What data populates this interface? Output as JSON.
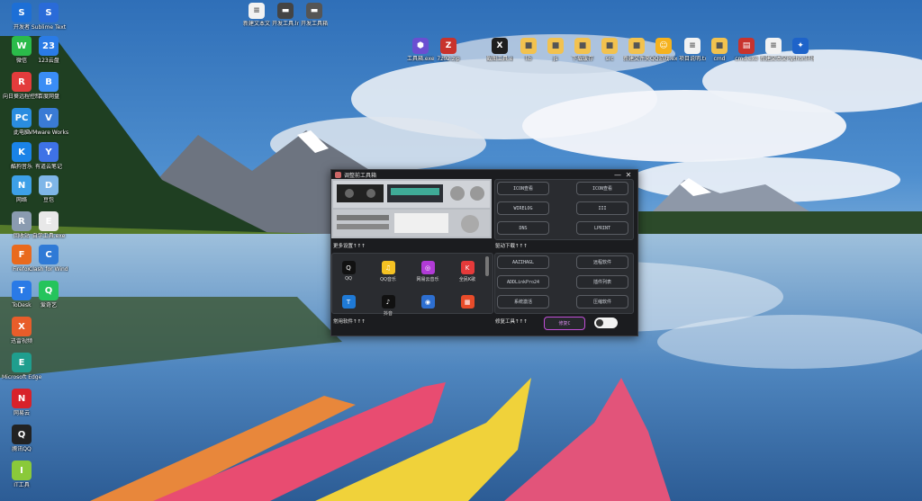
{
  "desktop": {
    "left_icons": [
      {
        "label": "开发者",
        "color": "#1d6fd6",
        "glyph": "S"
      },
      {
        "label": "Sublime Text",
        "color": "#2a6bd8",
        "glyph": "S"
      },
      {
        "label": "微信",
        "color": "#2bbb4a",
        "glyph": "W"
      },
      {
        "label": "123云盘",
        "color": "#2a7be6",
        "glyph": "23"
      },
      {
        "label": "向日葵远程控制",
        "color": "#e33c3c",
        "glyph": "R"
      },
      {
        "label": "百度网盘",
        "color": "#3a8df5",
        "glyph": "B"
      },
      {
        "label": "此电脑",
        "color": "#2a8de0",
        "glyph": "PC"
      },
      {
        "label": "VMware Workstat...",
        "color": "#3a7bd5",
        "glyph": "V"
      },
      {
        "label": "酷狗音乐",
        "color": "#1a83e8",
        "glyph": "K"
      },
      {
        "label": "有道云笔记",
        "color": "#3e72e6",
        "glyph": "Y"
      },
      {
        "label": "网络",
        "color": "#3da0e8",
        "glyph": "N"
      },
      {
        "label": "豆包",
        "color": "#7fb6e8",
        "glyph": "D"
      },
      {
        "label": "回收站",
        "color": "#8a9bb0",
        "glyph": "R"
      },
      {
        "label": "自学工具.exe",
        "color": "#e8e8e8",
        "glyph": "E"
      },
      {
        "label": "Firefox",
        "color": "#e96a1e",
        "glyph": "F"
      },
      {
        "label": "Clash for Windows",
        "color": "#2f7ad6",
        "glyph": "C"
      },
      {
        "label": "ToDesk",
        "color": "#2a7ae6",
        "glyph": "T"
      },
      {
        "label": "爱奇艺",
        "color": "#25c45c",
        "glyph": "Q"
      },
      {
        "label": "迅雷视频",
        "color": "#e85d2a",
        "glyph": "X"
      },
      {
        "label": "Microsoft Edge",
        "color": "#1f9e8e",
        "glyph": "E"
      },
      {
        "label": "网易云",
        "color": "#d8222a",
        "glyph": "N"
      },
      {
        "label": "腾讯QQ",
        "color": "#222",
        "glyph": "Q"
      },
      {
        "label": "IT工具",
        "color": "#8ac93a",
        "glyph": "I"
      }
    ],
    "top_icons": [
      {
        "label": "新建文本文档.txt",
        "color": "#f2f2f2",
        "glyph": "≡"
      },
      {
        "label": "开发工具.lnk",
        "color": "#444",
        "glyph": "▬"
      },
      {
        "label": "开发工具箱.lnk",
        "color": "#555",
        "glyph": "▬"
      },
      {
        "label": "工具箱.exe",
        "color": "#6a4fd1",
        "glyph": "⬢"
      },
      {
        "label": "7z02.zip",
        "color": "#c8332d",
        "glyph": "Z"
      },
      {
        "label": "截图工具.exe",
        "color": "#1e1e1e",
        "glyph": "X"
      },
      {
        "label": "lib",
        "color": "#f2c24f",
        "glyph": "■"
      },
      {
        "label": "js",
        "color": "#f2c24f",
        "glyph": "■"
      },
      {
        "label": "下载缓存",
        "color": "#f2c24f",
        "glyph": "■"
      },
      {
        "label": "src",
        "color": "#f2c24f",
        "glyph": "■"
      },
      {
        "label": "新建文件夹",
        "color": "#f2c24f",
        "glyph": "■"
      },
      {
        "label": "QQ游戏.exe",
        "color": "#f5b21e",
        "glyph": "☺"
      },
      {
        "label": "项目说明.txt",
        "color": "#f2f2f2",
        "glyph": "≡"
      },
      {
        "label": "cmd",
        "color": "#f2c24f",
        "glyph": "■"
      },
      {
        "label": "cmd.exe",
        "color": "#c8332d",
        "glyph": "▤"
      },
      {
        "label": "新建文本文档.txt",
        "color": "#f2f2f2",
        "glyph": "≡"
      },
      {
        "label": "Python环境.exe",
        "color": "#1e63c9",
        "glyph": "✦"
      }
    ]
  },
  "window": {
    "title": "调整前工具箱",
    "controls": [
      "—",
      "✕"
    ],
    "right_buttons_top": [
      "ICON查看",
      "ICON查看",
      "WIRELOG",
      "III",
      "DNS",
      "LPRINT"
    ],
    "section_driver": "驱动下载↑↑↑",
    "right_buttons_bottom": [
      "AAZIHAGL",
      "远程软件",
      "ADDLinkPro24",
      "插件列表",
      "系统激活",
      "压缩软件"
    ],
    "section_more": "更多设置↑↑↑",
    "apps": [
      {
        "label": "QQ",
        "color": "#111",
        "glyph": "Q"
      },
      {
        "label": "QQ音乐",
        "color": "#f5c223",
        "glyph": "♫"
      },
      {
        "label": "网易云音乐",
        "color": "#b13bd6",
        "glyph": "◎"
      },
      {
        "label": "全民K歌",
        "color": "#e53a3a",
        "glyph": "K"
      },
      {
        "label": "",
        "color": "#1f7ad6",
        "glyph": "T"
      },
      {
        "label": "抖音",
        "color": "#111",
        "glyph": "♪"
      },
      {
        "label": "",
        "color": "#2d6fd1",
        "glyph": "◉"
      },
      {
        "label": "",
        "color": "#e84c2a",
        "glyph": "▦"
      }
    ],
    "section_common": "常用软件↑↑↑",
    "section_fix": "修复工具↑↑↑",
    "fix_button": "修复C",
    "accent": "#c24fd8"
  }
}
